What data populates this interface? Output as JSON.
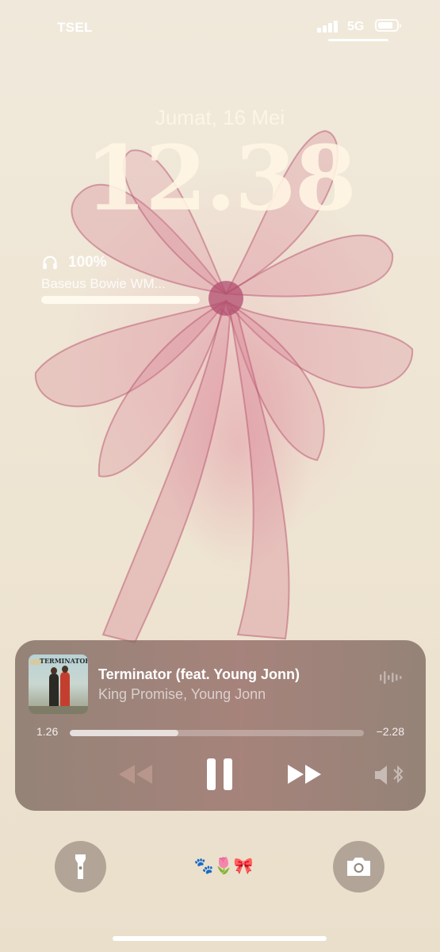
{
  "status_bar": {
    "carrier": "TSEL",
    "network": "5G",
    "battery_level": 0.85
  },
  "lock_screen": {
    "date": "Jumat, 16 Mei",
    "time": "12.38"
  },
  "headphone_widget": {
    "icon": "headphones-icon",
    "battery_percent": "100%",
    "battery_level": 1.0,
    "device_name": "Baseus Bowie WM..."
  },
  "now_playing": {
    "album_art_text": "TERMINATOR",
    "title": "Terminator (feat. Young Jonn)",
    "artist": "King Promise, Young Jonn",
    "elapsed": "1.26",
    "remaining": "−2.28",
    "progress": 0.37,
    "controls": {
      "rewind_icon": "rewind-icon",
      "pause_icon": "pause-icon",
      "forward_icon": "fast-forward-icon",
      "output_icon": "speaker-bluetooth-icon",
      "waveform_icon": "waveform-icon"
    }
  },
  "bottom": {
    "flashlight_icon": "flashlight-icon",
    "camera_icon": "camera-icon",
    "emoji_widget": "🐾🌷🎀"
  },
  "colors": {
    "wallpaper": "#efe6d6",
    "bow": "#d98a9a",
    "player_bg": "#8c6e66"
  }
}
